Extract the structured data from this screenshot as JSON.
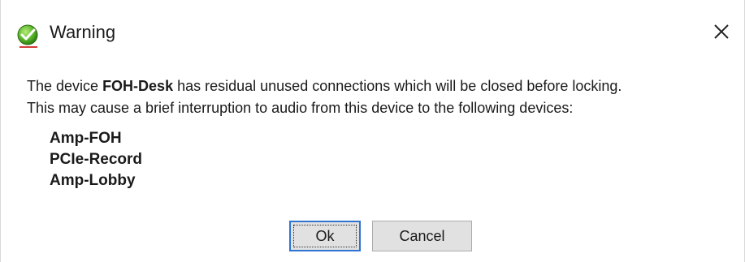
{
  "window": {
    "title": "Warning",
    "icon": "green-check-globe-icon",
    "close_glyph": "✕"
  },
  "message": {
    "line1_prefix": "The device ",
    "device_name": "FOH-Desk",
    "line1_suffix": " has residual unused connections which will be closed before locking.",
    "line2": "This may cause a brief interruption to audio from this device to the following devices:"
  },
  "devices": [
    "Amp-FOH",
    "PCIe-Record",
    "Amp-Lobby"
  ],
  "buttons": {
    "ok_label": "Ok",
    "cancel_label": "Cancel"
  },
  "colors": {
    "focus_border": "#2f74d0",
    "button_bg": "#e1e1e1",
    "icon_green": "#5cb82e"
  }
}
